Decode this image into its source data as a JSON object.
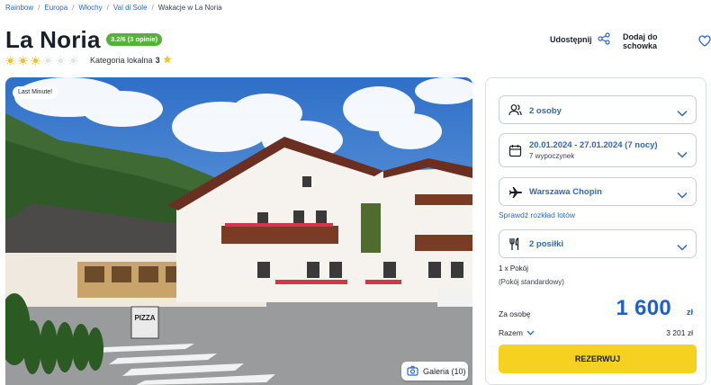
{
  "breadcrumb": {
    "items": [
      "Rainbow",
      "Europa",
      "Włochy",
      "Val di Sole"
    ],
    "current": "Wakacje w La Noria"
  },
  "hotel": {
    "name": "La Noria",
    "rating_badge": "3.2/6 (3 opinie)",
    "stars_filled": 3,
    "stars_total": 6,
    "category_label": "Kategoria lokalna",
    "category_value": "3"
  },
  "actions": {
    "share_label": "Udostępnij",
    "favorite_label": "Dodaj do schowka"
  },
  "photo": {
    "badge": "Last Minute!",
    "gallery_label": "Galeria (10)",
    "sign_text": "PIZZA"
  },
  "booking": {
    "persons": "2 osoby",
    "dates": "20.01.2024 - 27.01.2024 (7 nocy)",
    "stay_type": "7 wypoczynek",
    "airport": "Warszawa Chopin",
    "flight_link": "Sprawdź rozkład lotów",
    "meals": "2 posiłki",
    "room_count": "1 x Pokój",
    "room_type": "(Pokój standardowy)",
    "per_person_label": "Za osobę",
    "price": "1 600",
    "currency": "zł",
    "total_label": "Razem",
    "total_value": "3 201 zł",
    "book_label": "REZERWUJ"
  },
  "colors": {
    "accent_blue": "#2d66c8",
    "price_blue": "#1f5fcf",
    "badge_green": "#56b13a",
    "cta_yellow": "#f7d11f",
    "star_yellow": "#f5c518"
  }
}
